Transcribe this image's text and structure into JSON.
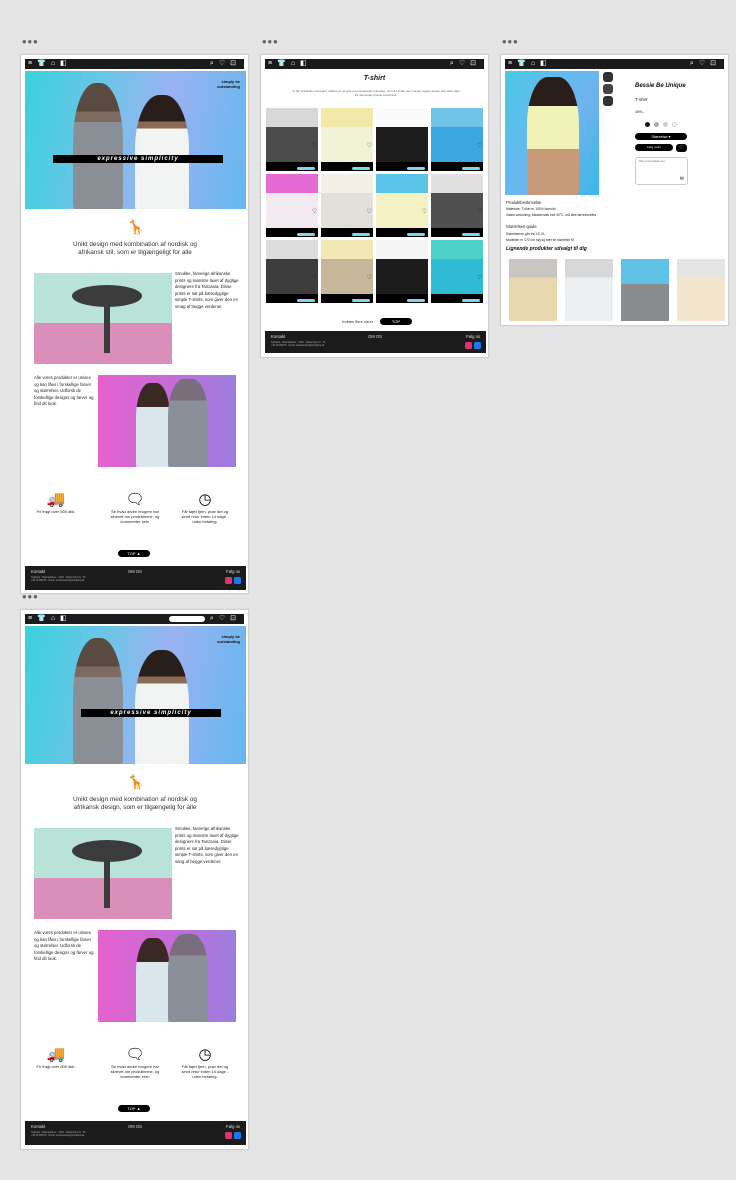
{
  "colors": {
    "accent": "#3ad1dc",
    "dark": "#1b1b1b",
    "pink": "#e879d5",
    "mint": "#7ed7e6"
  },
  "home": {
    "tagline": "simply be outstanding",
    "hero_title": "expressive simplicity",
    "intro": "Unikt design med kombination af nordisk og afrikansk stil, som er tilgængeligt for alle",
    "desc1": "Smukke, farverige afrikanske prints og mønstre lavet af dygtige designere fra Tanzania. Disse prints er sat på bæredygtige simple T-shirts, som giver den en smag af begge verdener.",
    "desc2": "Alle vores produkter er unisex og kan fåes i forskellige farver og størrelser. Udforsk de forskellige designs og farver og find dit look.",
    "feat1": "Fri fragt over 500 dkk.",
    "feat2": "Se hvad andre brugere har skrevet om produkterne, og kommenter selv.",
    "feat3": "Får tøjet fjern, prøv det og send retur inden 14 dage - uden betaling.",
    "top": "TOP ▲"
  },
  "home2": {
    "intro": "Unikt design med kombination af nordisk og afrikansk design, som er tilgængelig for alle",
    "desc1": "Smukke, farverige afrikanske prints og mønstre lavet af dygtige designere fra Tanzania. Disse prints er sat på bæredygtige simple T-shirts, som giver den en sang af begge verdener.",
    "feat3": "Får tøjet fjern, prøv det og send retur inden 14 dage - uden betaling."
  },
  "footer": {
    "kontakt": "Kontakt",
    "om": "OM OS",
    "follow": "Følg os",
    "fine": "Sydbank · Bankaddress · 2200 · København N · Tlf. +45 12345678 · Email: ambassador@simplicity.dk"
  },
  "shop": {
    "title": "T-shirt",
    "subtitle": "Vi har praktiske oversigter i håbet om at give en overskuelig oplevelse, hvor du finder den mange vigtige design kan blive tøjet fra Tanzanias fineste kunstnere.",
    "card_label": "Se detaljer",
    "load_more": "Indlæs flere varer",
    "top": "TOP"
  },
  "product": {
    "name": "Bessie Be Unique",
    "type": "T-shirt",
    "price": "199,-",
    "size_btn": "Størrelse ▾",
    "cart_btn": "Læg i kurv",
    "review_placeholder": "Skriv en anmeldelse her...",
    "desc_head": "Produktbeskrivelse",
    "desc1": "Materiale: T-shirt er 100% bomuld",
    "desc2": "Vaske-anvisning: Maskinvask ved 40°C, må ikke tørretumbles",
    "size_head": "Størrelses-guide",
    "size1": "Størrelserne går fra XS-XL.",
    "size2": "Modellen er 170 cm høj og bær en størrelse M.",
    "related": "Lignende produkter udvalgt til dig"
  }
}
